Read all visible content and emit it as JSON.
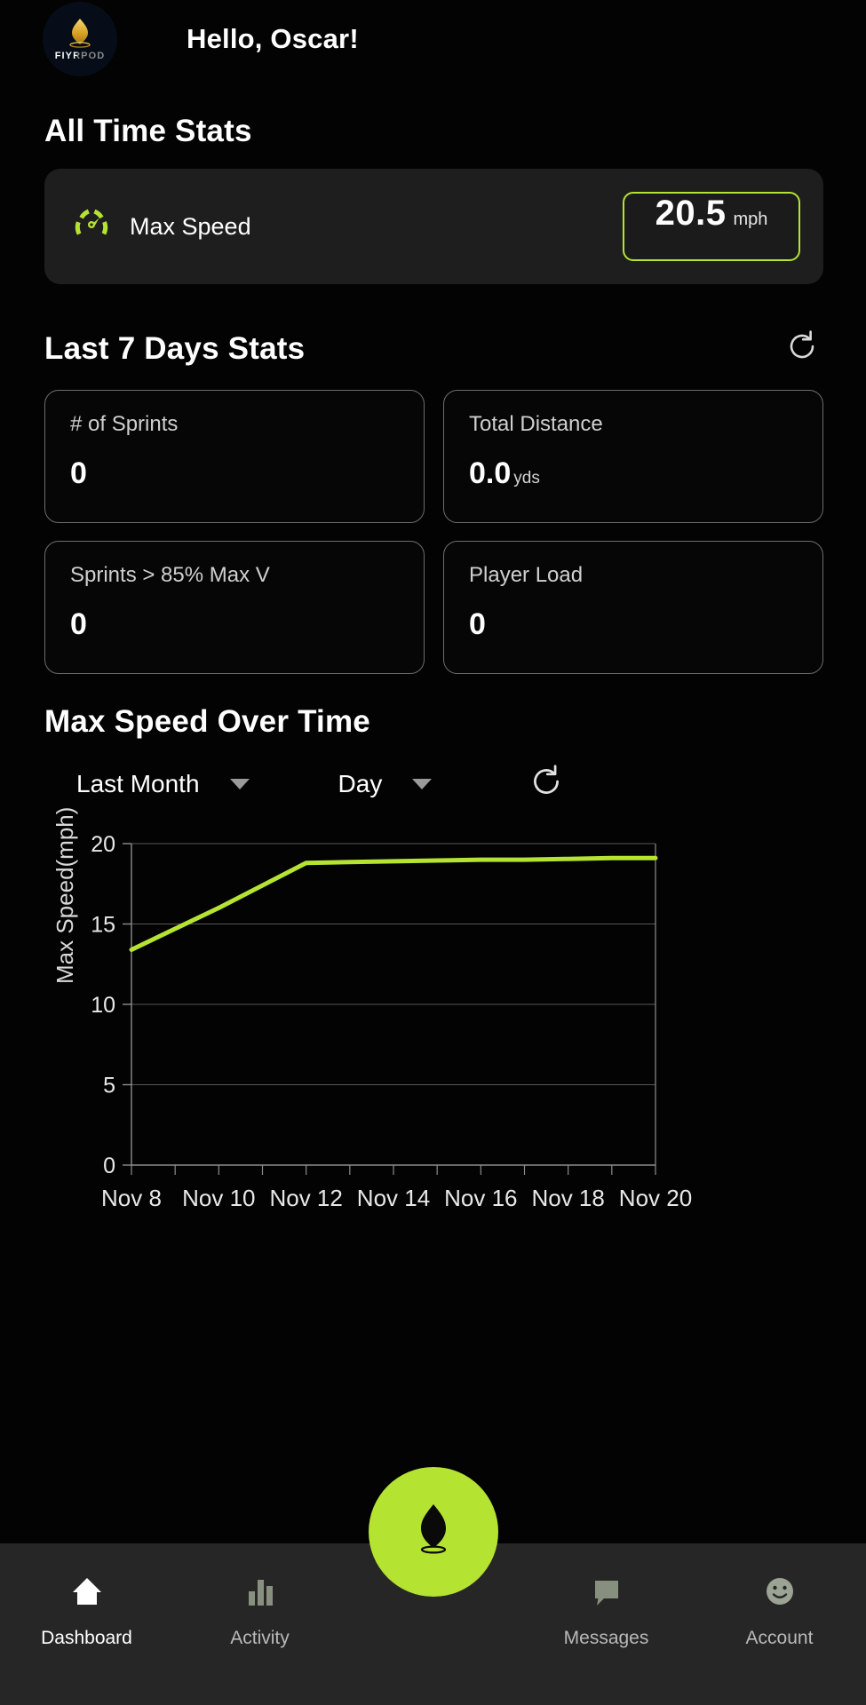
{
  "header": {
    "logo_word": "FIYRPOD",
    "logo_icon": "flame-icon",
    "greeting": "Hello, Oscar!"
  },
  "all_time": {
    "title": "All Time Stats",
    "metric_icon": "speedometer-icon",
    "metric_label": "Max Speed",
    "value": "20.5",
    "unit": "mph"
  },
  "last7": {
    "title": "Last 7 Days Stats",
    "refresh_icon": "refresh-icon",
    "cards": [
      {
        "label": "# of Sprints",
        "value": "0",
        "suffix": ""
      },
      {
        "label": "Total Distance",
        "value": "0.0",
        "suffix": "yds"
      },
      {
        "label": "Sprints > 85% Max V",
        "value": "0",
        "suffix": ""
      },
      {
        "label": "Player Load",
        "value": "0",
        "suffix": ""
      }
    ]
  },
  "chart_section": {
    "title": "Max Speed Over Time",
    "range_dropdown": "Last Month",
    "granularity_dropdown": "Day",
    "refresh_icon": "refresh-icon"
  },
  "chart_data": {
    "type": "line",
    "title": "Max Speed Over Time",
    "xlabel": "",
    "ylabel": "Max Speed(mph)",
    "ylim": [
      0,
      20
    ],
    "yticks": [
      0,
      5,
      10,
      15,
      20
    ],
    "xticks": [
      "Nov 8",
      "Nov 10",
      "Nov 12",
      "Nov 14",
      "Nov 16",
      "Nov 18",
      "Nov 20"
    ],
    "grid": true,
    "legend": "none",
    "line_color": "#b5e332",
    "x": [
      "Nov 8",
      "Nov 9",
      "Nov 10",
      "Nov 11",
      "Nov 12",
      "Nov 13",
      "Nov 14",
      "Nov 15",
      "Nov 16",
      "Nov 17",
      "Nov 18",
      "Nov 19",
      "Nov 20"
    ],
    "values": [
      13.4,
      14.7,
      16.0,
      17.4,
      18.8,
      18.85,
      18.9,
      18.95,
      19.0,
      19.0,
      19.05,
      19.1,
      19.1
    ]
  },
  "bottom_nav": {
    "items": [
      {
        "label": "Dashboard",
        "icon": "home-icon",
        "active": true
      },
      {
        "label": "Activity",
        "icon": "bar-chart-icon",
        "active": false
      },
      {
        "label": "Messages",
        "icon": "message-bubble-icon",
        "active": false
      },
      {
        "label": "Account",
        "icon": "smiley-face-icon",
        "active": false
      }
    ],
    "fab_icon": "flame-icon"
  },
  "colors": {
    "accent_green": "#b5e332",
    "background": "#030303",
    "card": "#1e1e1e",
    "nav_bar": "#262626"
  }
}
